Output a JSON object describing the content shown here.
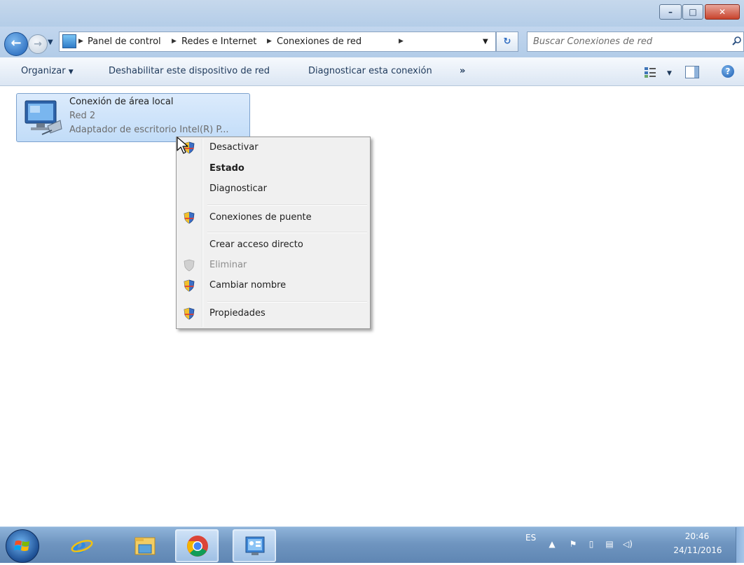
{
  "window": {
    "buttons": {
      "minimize": "–",
      "maximize": "□",
      "close": "✕"
    }
  },
  "navigation": {
    "breadcrumbs": [
      "Panel de control",
      "Redes e Internet",
      "Conexiones de red"
    ],
    "search_placeholder": "Buscar Conexiones de red",
    "refresh_symbol": "↻"
  },
  "toolbar": {
    "organize": "Organizar",
    "disable_device": "Deshabilitar este dispositivo de red",
    "diagnose": "Diagnosticar esta conexión",
    "more": "»",
    "help": "?"
  },
  "connection": {
    "name": "Conexión de área local",
    "network": "Red 2",
    "adapter": "Adaptador de escritorio Intel(R) P..."
  },
  "context_menu": {
    "items": [
      {
        "label": "Desactivar",
        "shield": true,
        "bold": false,
        "disabled": false
      },
      {
        "label": "Estado",
        "shield": false,
        "bold": true,
        "disabled": false
      },
      {
        "label": "Diagnosticar",
        "shield": false,
        "bold": false,
        "disabled": false
      },
      {
        "label": "Conexiones de puente",
        "shield": true,
        "bold": false,
        "disabled": false
      },
      {
        "label": "Crear acceso directo",
        "shield": false,
        "bold": false,
        "disabled": false
      },
      {
        "label": "Eliminar",
        "shield": true,
        "bold": false,
        "disabled": true
      },
      {
        "label": "Cambiar nombre",
        "shield": true,
        "bold": false,
        "disabled": false
      },
      {
        "label": "Propiedades",
        "shield": true,
        "bold": false,
        "disabled": false
      }
    ]
  },
  "taskbar": {
    "apps": [
      "internet-explorer",
      "windows-explorer",
      "chrome",
      "network-connections"
    ],
    "language": "ES",
    "time": "20:46",
    "date": "24/11/2016"
  },
  "colors": {
    "accent": "#1d60b6",
    "selection": "#c1dcf8",
    "taskbar": "#6f95c0"
  }
}
